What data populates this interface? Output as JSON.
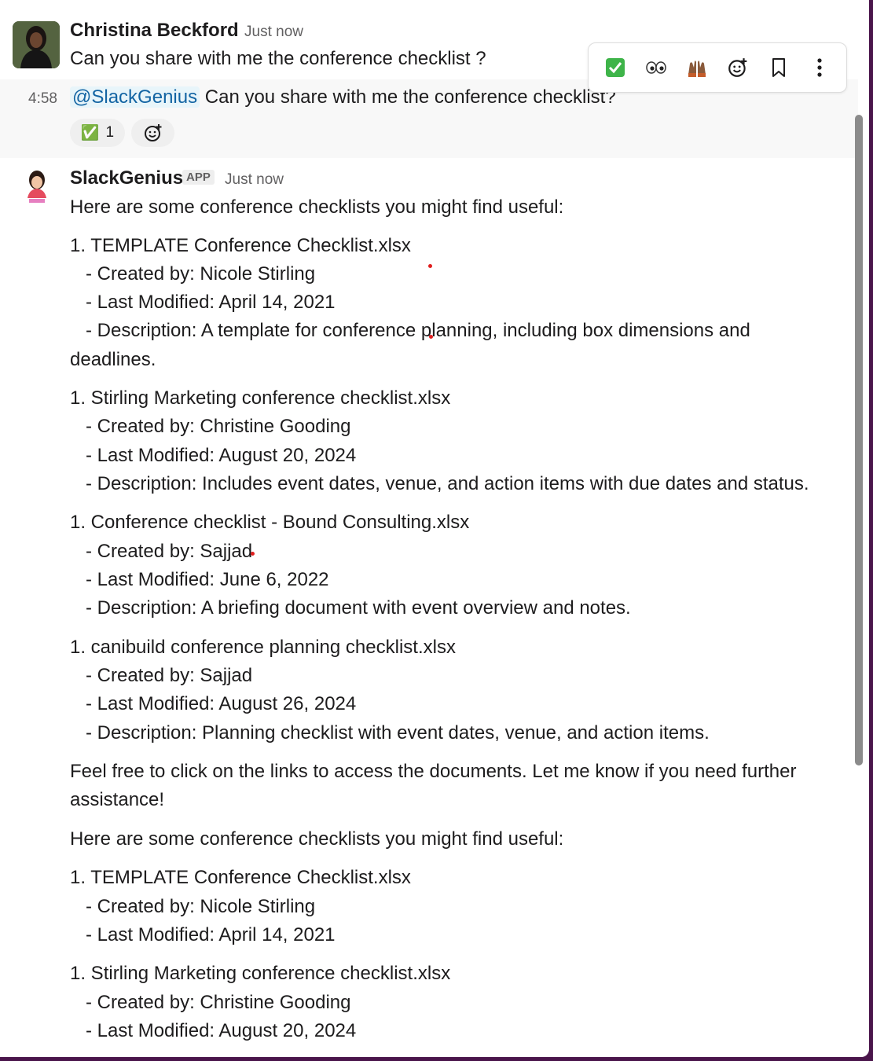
{
  "msg1": {
    "sender": "Christina Beckford",
    "timestamp": "Just now",
    "text": "Can you share with me  the conference checklist ?"
  },
  "toolbar": {
    "items": [
      "check-reaction",
      "eyes-reaction",
      "raised-hands-reaction",
      "add-reaction",
      "bookmark",
      "more-actions"
    ]
  },
  "msg2": {
    "time": "4:58",
    "mention": "@SlackGenius",
    "text": " Can you share with me the conference checklist?",
    "reaction_emoji": "✅",
    "reaction_count": "1"
  },
  "msg3": {
    "sender": "SlackGenius",
    "badge": "APP",
    "timestamp": "Just now",
    "lines": [
      "Here are some conference checklists you might find useful:",
      "1. TEMPLATE Conference Checklist.xlsx",
      "   - Created by: Nicole Stirling",
      "   - Last Modified: April 14, 2021",
      "   - Description: A template for conference planning, including box dimensions and",
      "deadlines.",
      "1. Stirling Marketing conference checklist.xlsx",
      "   - Created by: Christine Gooding",
      "   - Last Modified: August 20, 2024",
      "   - Description: Includes event dates, venue, and action items with due dates and status.",
      "1. Conference checklist - Bound Consulting.xlsx",
      "   - Created by: Sajjad",
      "   - Last Modified: June 6, 2022",
      "   - Description: A briefing document with event overview and notes.",
      "1. canibuild conference planning checklist.xlsx",
      "   - Created by: Sajjad",
      "   - Last Modified: August 26, 2024",
      "   - Description: Planning checklist with event dates, venue, and action items.",
      "Feel free to click on the links to access the documents. Let me know if you need further",
      "assistance!",
      "Here are some conference checklists you might find useful:",
      "1. TEMPLATE Conference Checklist.xlsx",
      "   - Created by: Nicole Stirling",
      "   - Last Modified: April 14, 2021",
      "1. Stirling Marketing conference checklist.xlsx",
      "   - Created by: Christine Gooding",
      "   - Last Modified: August 20, 2024"
    ]
  },
  "colors": {
    "mention_bg": "#e8f5fa",
    "mention_fg": "#1264a3",
    "frame": "#4a154b"
  }
}
